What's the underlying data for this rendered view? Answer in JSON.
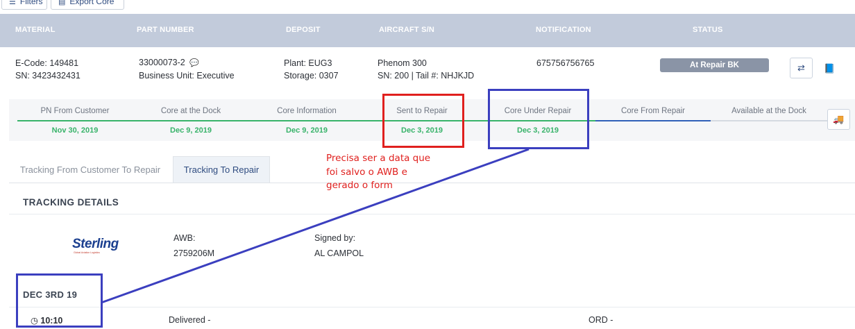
{
  "toolbar": {
    "filters_label": "Filters",
    "export_label": "Export Core"
  },
  "table": {
    "headers": [
      "MATERIAL",
      "PART NUMBER",
      "DEPOSIT",
      "AIRCRAFT S/N",
      "NOTIFICATION",
      "STATUS"
    ],
    "row": {
      "material_code": "E-Code: 149481",
      "material_sn": "SN: 3423432431",
      "part_number": "33000073-2",
      "business_unit": "Business Unit: Executive",
      "plant": "Plant: EUG3",
      "storage": "Storage: 0307",
      "aircraft": "Phenom 300",
      "aircraft_sn": "SN: 200 | Tail #: NHJKJD",
      "notification": "675756756765",
      "status": "At Repair BK"
    }
  },
  "timeline": {
    "steps": [
      {
        "label": "PN From Customer",
        "date": "Nov 30, 2019"
      },
      {
        "label": "Core at the Dock",
        "date": "Dec 9, 2019"
      },
      {
        "label": "Core Information",
        "date": "Dec 9, 2019"
      },
      {
        "label": "Sent to Repair",
        "date": "Dec 3, 2019"
      },
      {
        "label": "Core Under Repair",
        "date": "Dec 3, 2019"
      },
      {
        "label": "Core From Repair",
        "date": ""
      },
      {
        "label": "Available at the Dock",
        "date": ""
      }
    ],
    "colors": {
      "done": "#38b36a",
      "current": "#2f5fb8",
      "pending": "#d5dae1"
    }
  },
  "tabs": [
    {
      "label": "Tracking From Customer To Repair",
      "active": false
    },
    {
      "label": "Tracking To Repair",
      "active": true
    }
  ],
  "tracking": {
    "section_title": "TRACKING DETAILS",
    "carrier_logo": "Sterling",
    "carrier_tagline": "Global Aviation Logistics",
    "awb_label": "AWB:",
    "awb_value": "2759206M",
    "signed_label": "Signed by:",
    "signed_value": "AL CAMPOL",
    "date_heading": "DEC 3RD 19",
    "event_time": "10:10",
    "event_status": "Delivered -",
    "event_location": "ORD -"
  },
  "annotation": {
    "lines": [
      "Precisa ser a data que",
      "foi salvo o AWB e",
      "gerado o form"
    ],
    "colors": {
      "red": "#e0201e",
      "blue": "#3b3fbf"
    }
  },
  "icons": [
    "filter-icon",
    "export-icon",
    "comment-icon",
    "refresh-icon",
    "book-icon",
    "truck-icon",
    "clock-icon"
  ]
}
